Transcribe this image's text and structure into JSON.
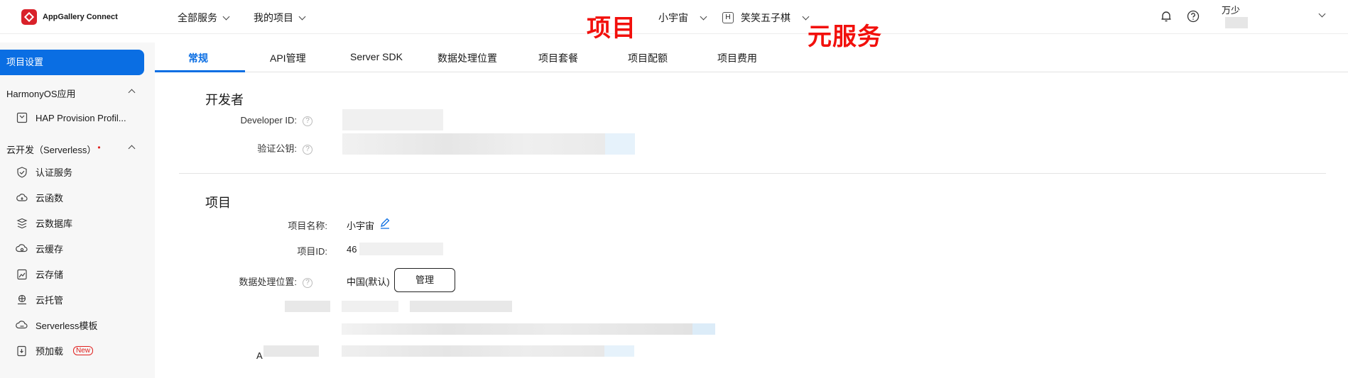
{
  "app": {
    "title": "AppGallery Connect"
  },
  "topnav": {
    "all_services": "全部服务",
    "my_projects": "我的项目",
    "project_name": "小宇宙",
    "app_badge": "H",
    "app_name": "笑笑五子棋"
  },
  "annotations": {
    "project": "项目",
    "meta_service": "元服务"
  },
  "user": {
    "name": "万少"
  },
  "sidebar": {
    "active": "项目设置",
    "group_harmony": "HarmonyOS应用",
    "harmony_item": "HAP Provision Profil...",
    "group_cloud": "云开发（Serverless）",
    "cloud_dot": "•",
    "items": [
      {
        "label": "认证服务",
        "icon": "shield-icon"
      },
      {
        "label": "云函数",
        "icon": "cloud-function-icon"
      },
      {
        "label": "云数据库",
        "icon": "database-icon"
      },
      {
        "label": "云缓存",
        "icon": "cache-icon"
      },
      {
        "label": "云存储",
        "icon": "storage-icon"
      },
      {
        "label": "云托管",
        "icon": "hosting-icon"
      },
      {
        "label": "Serverless模板",
        "icon": "template-icon"
      },
      {
        "label": "预加载",
        "icon": "preload-icon",
        "badge": "New"
      }
    ]
  },
  "tabs": [
    "常规",
    "API管理",
    "Server SDK",
    "数据处理位置",
    "项目套餐",
    "项目配额",
    "项目费用"
  ],
  "developer": {
    "title": "开发者",
    "id_label": "Developer ID:",
    "key_label": "验证公钥:"
  },
  "project": {
    "title": "项目",
    "name_label": "项目名称:",
    "name_value": "小宇宙",
    "id_label": "项目ID:",
    "id_value": "46",
    "location_label": "数据处理位置:",
    "location_value": "中国(默认)",
    "manage_button": "管理",
    "bottom_prefix": "A"
  },
  "colors": {
    "accent": "#0a6ee3",
    "annotation": "#f2100c",
    "brand": "#d9222a"
  }
}
